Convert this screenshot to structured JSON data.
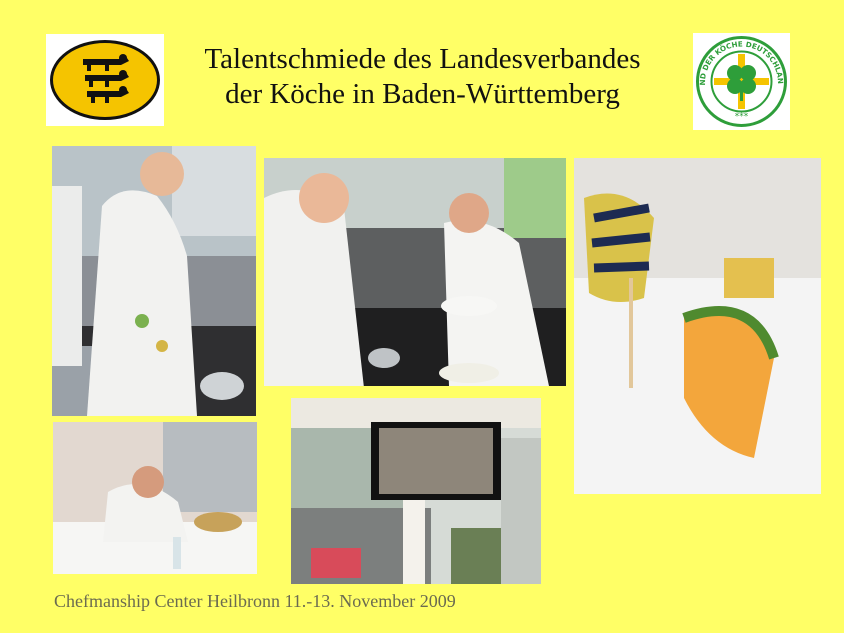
{
  "header": {
    "title_line1": "Talentschmiede des Landesverbandes",
    "title_line2": "der Köche in Baden-Württemberg"
  },
  "logos": {
    "left": {
      "icon": "baden-wuerttemberg-lions-crest-icon"
    },
    "right": {
      "icon": "clover-seal-icon",
      "seal_text": "VERBAND DER KÖCHE DEUTSCHLANDS e.V.",
      "stars": "***"
    }
  },
  "photos": [
    {
      "icon": "chef-plating-photo"
    },
    {
      "icon": "chefs-at-counter-photo"
    },
    {
      "icon": "vegetable-sculpture-photo"
    },
    {
      "icon": "judge-writing-photo"
    },
    {
      "icon": "tv-screen-photo"
    }
  ],
  "footer": {
    "caption": "Chefmanship Center Heilbronn 11.-13. November 2009"
  },
  "colors": {
    "background": "#ffff66",
    "crest_gold": "#f5c400",
    "seal_green": "#2e9e3a"
  }
}
